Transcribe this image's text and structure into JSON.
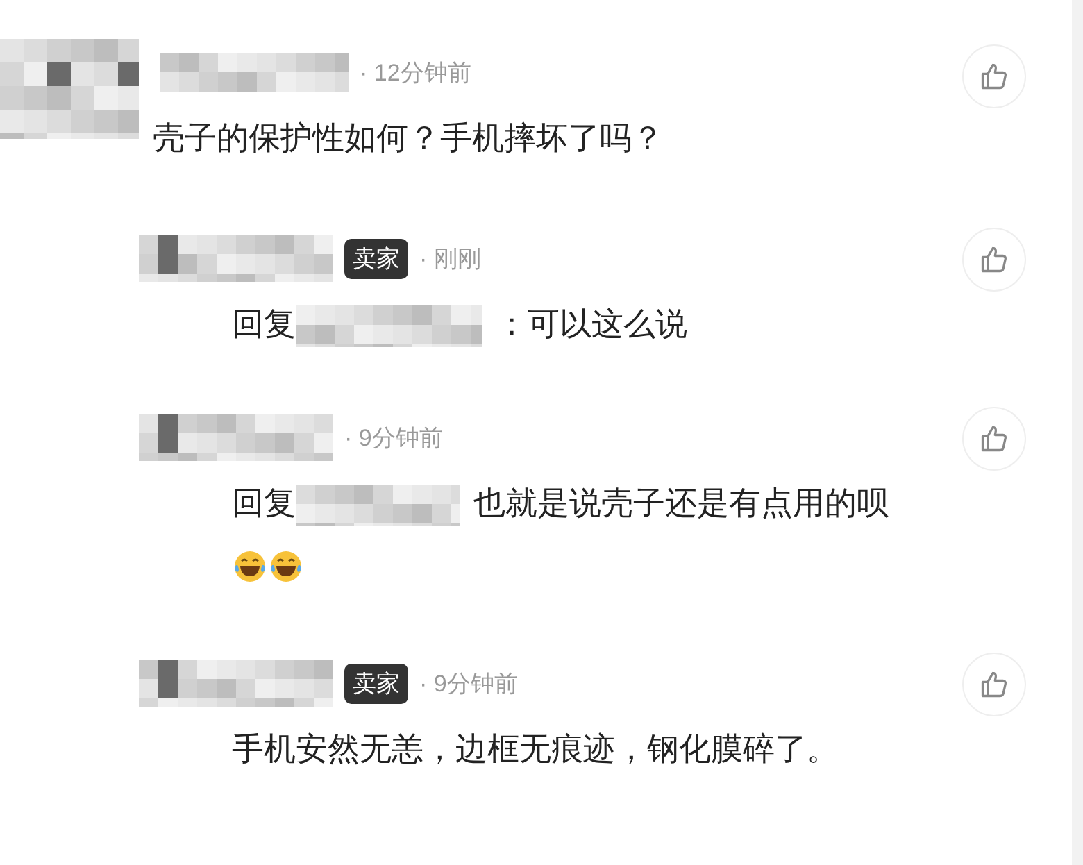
{
  "comment": {
    "time": "· 12分钟前",
    "text": "壳子的保护性如何？手机摔坏了吗？",
    "replies": [
      {
        "time": "· 刚刚",
        "seller_badge": "卖家",
        "reply_prefix": "回复",
        "text": "：可以这么说"
      },
      {
        "time": "· 9分钟前",
        "reply_prefix": "回复",
        "text": "也就是说壳子还是有点用的呗",
        "emojis": [
          {
            "kind": "laugh"
          },
          {
            "kind": "laugh"
          }
        ]
      },
      {
        "time": "· 9分钟前",
        "seller_badge": "卖家",
        "text": "手机安然无恙，边框无痕迹，钢化膜碎了。"
      }
    ]
  }
}
